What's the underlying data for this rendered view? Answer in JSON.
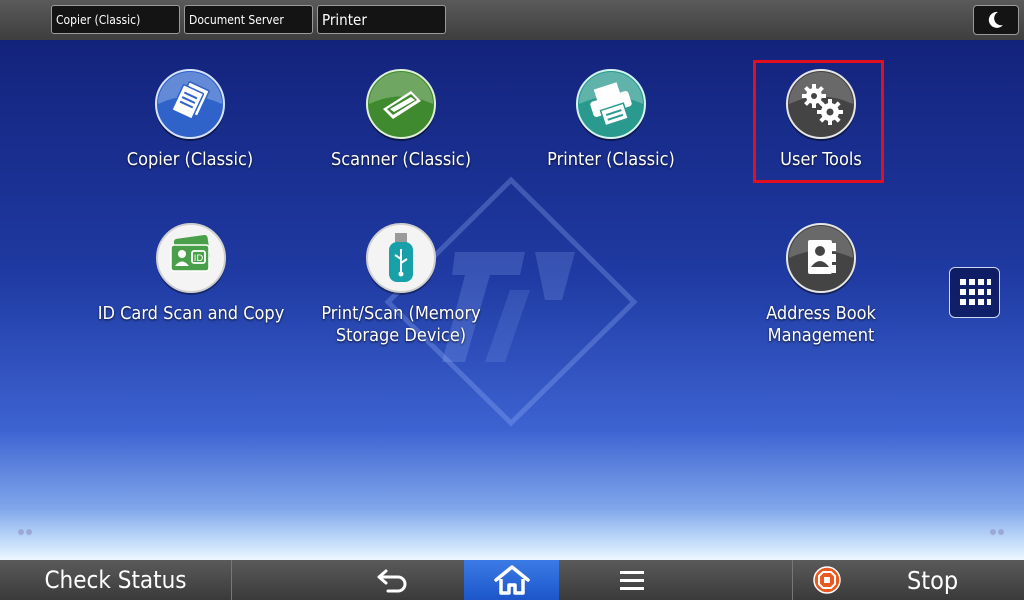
{
  "top_bar": {
    "modes": [
      "Copier (Classic)",
      "Document Server",
      "Printer"
    ],
    "sleep_icon": "moon-icon"
  },
  "apps": [
    {
      "label_lines": [
        "Copier (Classic)"
      ],
      "icon": "copier-icon",
      "color": "#2f63c9"
    },
    {
      "label_lines": [
        "Scanner (Classic)"
      ],
      "icon": "scanner-icon",
      "color": "#3f8a2e"
    },
    {
      "label_lines": [
        "Printer (Classic)"
      ],
      "icon": "printer-icon",
      "color": "#2a9a8e"
    },
    {
      "label_lines": [
        "User Tools"
      ],
      "icon": "gear-icon",
      "color": "#444444"
    },
    {
      "label_lines": [
        "ID Card Scan and Copy"
      ],
      "icon": "id-card-icon",
      "color": "#4aa04a"
    },
    {
      "label_lines": [
        "Print/Scan (Memory",
        "Storage Device)"
      ],
      "icon": "usb-icon",
      "color": "#17a0a8"
    },
    {
      "label_lines": [
        "Address Book",
        "Management"
      ],
      "icon": "address-book-icon",
      "color": "#444444"
    }
  ],
  "side": {
    "app_list_icon": "grid-icon",
    "page_dots": "page-indicator-icon"
  },
  "bottom_bar": {
    "check_status": "Check Status",
    "back_icon": "back-arrow-icon",
    "home_icon": "home-icon",
    "menu_icon": "menu-icon",
    "stop_icon": "stop-icon",
    "stop_label": "Stop"
  },
  "colors": {
    "highlight": "#e01020",
    "home_active": "#2a6bd9",
    "stop_icon": "#e85a20"
  }
}
